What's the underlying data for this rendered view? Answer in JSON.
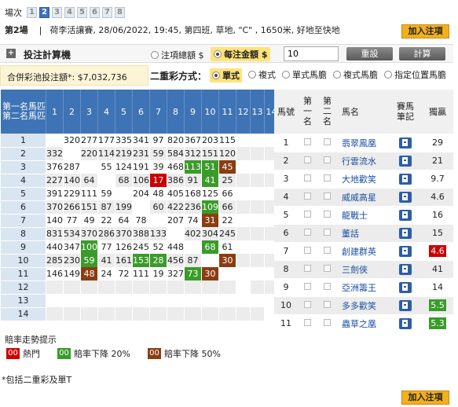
{
  "race_selector": {
    "label": "場次",
    "races": [
      "1",
      "2",
      "3",
      "4",
      "5",
      "6",
      "7",
      "8"
    ],
    "selected": "2"
  },
  "race_info": {
    "race_no": "第2場",
    "separator": "|",
    "details": "荷李活讓賽, 28/06/2022, 19:45, 第四班, 草地, \"C\" , 1650米, 好地至快地"
  },
  "add_slip_label": "加入注項",
  "calculator": {
    "title": "投注計算機",
    "option1": "注項總額 $",
    "option2": "每注金額 $",
    "amount_value": "10",
    "reset_label": "重設",
    "calc_label": "計算"
  },
  "total": {
    "label": "合併彩池投注額*:",
    "value": "$7,032,736"
  },
  "bet_type": {
    "label": "二重彩方式：",
    "options": [
      "單式",
      "複式",
      "單式馬膽",
      "複式馬膽",
      "指定位置馬膽"
    ],
    "selected_index": 0
  },
  "grid": {
    "corner_top": "第一名馬匹",
    "corner_bottom": "第二名馬匹",
    "columns": [
      "1",
      "2",
      "3",
      "4",
      "5",
      "6",
      "7",
      "8",
      "9",
      "10",
      "11",
      "12",
      "13",
      "14"
    ],
    "rows": [
      {
        "label": "1",
        "cells": [
          "",
          "320",
          "277",
          "177",
          "335",
          "341",
          "97",
          "820",
          "367",
          "203",
          "115",
          "",
          "",
          ""
        ]
      },
      {
        "label": "2",
        "cells": [
          "332",
          "",
          "220",
          "114",
          "219",
          "231",
          "59",
          "584",
          "312",
          "151",
          "120",
          "",
          "",
          ""
        ]
      },
      {
        "label": "3",
        "cells": [
          "376",
          "287",
          "",
          "55",
          "124",
          "191",
          "39",
          "468",
          "113",
          "51",
          "45",
          "",
          "",
          ""
        ]
      },
      {
        "label": "4",
        "cells": [
          "227",
          "140",
          "64",
          "",
          "68",
          "106",
          "17",
          "386",
          "91",
          "41",
          "25",
          "",
          "",
          ""
        ]
      },
      {
        "label": "5",
        "cells": [
          "391",
          "229",
          "111",
          "59",
          "",
          "204",
          "48",
          "405",
          "168",
          "125",
          "66",
          "",
          "",
          ""
        ]
      },
      {
        "label": "6",
        "cells": [
          "370",
          "266",
          "151",
          "87",
          "199",
          "",
          "60",
          "422",
          "236",
          "109",
          "66",
          "",
          "",
          ""
        ]
      },
      {
        "label": "7",
        "cells": [
          "140",
          "77",
          "49",
          "22",
          "64",
          "78",
          "",
          "207",
          "74",
          "31",
          "22",
          "",
          "",
          ""
        ]
      },
      {
        "label": "8",
        "cells": [
          "831",
          "534",
          "370",
          "286",
          "370",
          "388",
          "133",
          "",
          "402",
          "304",
          "245",
          "",
          "",
          ""
        ]
      },
      {
        "label": "9",
        "cells": [
          "440",
          "347",
          "100",
          "77",
          "126",
          "245",
          "52",
          "448",
          "",
          "68",
          "61",
          "",
          "",
          ""
        ]
      },
      {
        "label": "10",
        "cells": [
          "285",
          "230",
          "59",
          "41",
          "161",
          "153",
          "28",
          "456",
          "87",
          "",
          "30",
          "",
          "",
          ""
        ]
      },
      {
        "label": "11",
        "cells": [
          "146",
          "149",
          "48",
          "24",
          "72",
          "111",
          "19",
          "327",
          "73",
          "30",
          "",
          "",
          "",
          ""
        ]
      },
      {
        "label": "12",
        "cells": [
          "",
          "",
          "",
          "",
          "",
          "",
          "",
          "",
          "",
          "",
          "",
          "",
          "",
          ""
        ]
      },
      {
        "label": "13",
        "cells": [
          "",
          "",
          "",
          "",
          "",
          "",
          "",
          "",
          "",
          "",
          "",
          "",
          "",
          ""
        ]
      },
      {
        "label": "14",
        "cells": [
          "",
          "",
          "",
          "",
          "",
          "",
          "",
          "",
          "",
          "",
          "",
          "",
          "",
          ""
        ]
      }
    ],
    "highlights": [
      {
        "row": 2,
        "col": 8,
        "type": "d20"
      },
      {
        "row": 2,
        "col": 9,
        "type": "d20"
      },
      {
        "row": 2,
        "col": 10,
        "type": "d50"
      },
      {
        "row": 3,
        "col": 6,
        "type": "hot"
      },
      {
        "row": 3,
        "col": 9,
        "type": "d20"
      },
      {
        "row": 5,
        "col": 9,
        "type": "d20"
      },
      {
        "row": 6,
        "col": 9,
        "type": "d50"
      },
      {
        "row": 8,
        "col": 2,
        "type": "d20"
      },
      {
        "row": 8,
        "col": 9,
        "type": "d20"
      },
      {
        "row": 9,
        "col": 2,
        "type": "d20"
      },
      {
        "row": 9,
        "col": 5,
        "type": "d20"
      },
      {
        "row": 9,
        "col": 6,
        "type": "d20"
      },
      {
        "row": 9,
        "col": 10,
        "type": "d50"
      },
      {
        "row": 10,
        "col": 2,
        "type": "d50"
      },
      {
        "row": 10,
        "col": 8,
        "type": "d20"
      },
      {
        "row": 10,
        "col": 9,
        "type": "d50"
      }
    ]
  },
  "horse_table": {
    "headers": {
      "no": "馬號",
      "first": "第一名",
      "second": "第二名",
      "name": "馬名",
      "note": "賽馬筆記",
      "win": "獨贏"
    },
    "horses": [
      {
        "no": "1",
        "name": "翡翠鳳凰",
        "win": "29",
        "win_style": ""
      },
      {
        "no": "2",
        "name": "行雲流水",
        "win": "21",
        "win_style": ""
      },
      {
        "no": "3",
        "name": "大地歡笑",
        "win": "9.7",
        "win_style": ""
      },
      {
        "no": "4",
        "name": "威威高星",
        "win": "4.6",
        "win_style": ""
      },
      {
        "no": "5",
        "name": "龍戰士",
        "win": "16",
        "win_style": ""
      },
      {
        "no": "6",
        "name": "董話",
        "win": "15",
        "win_style": ""
      },
      {
        "no": "7",
        "name": "創建群英",
        "win": "4.6",
        "win_style": "hot"
      },
      {
        "no": "8",
        "name": "三劍俠",
        "win": "41",
        "win_style": ""
      },
      {
        "no": "9",
        "name": "亞洲籌王",
        "win": "14",
        "win_style": ""
      },
      {
        "no": "10",
        "name": "多多歡笑",
        "win": "5.5",
        "win_style": "d20"
      },
      {
        "no": "11",
        "name": "蟲草之凰",
        "win": "5.3",
        "win_style": "d20"
      }
    ]
  },
  "legend": {
    "title": "賠率走勢提示",
    "swatch_text": "00",
    "items": [
      {
        "label": "熱門",
        "color": "#cc0000"
      },
      {
        "label": "賠率下降 20%",
        "color": "#3b9b2a"
      },
      {
        "label": "賠率下降 50%",
        "color": "#8b3d12"
      }
    ]
  },
  "footnote": "*包括二重彩及單T"
}
